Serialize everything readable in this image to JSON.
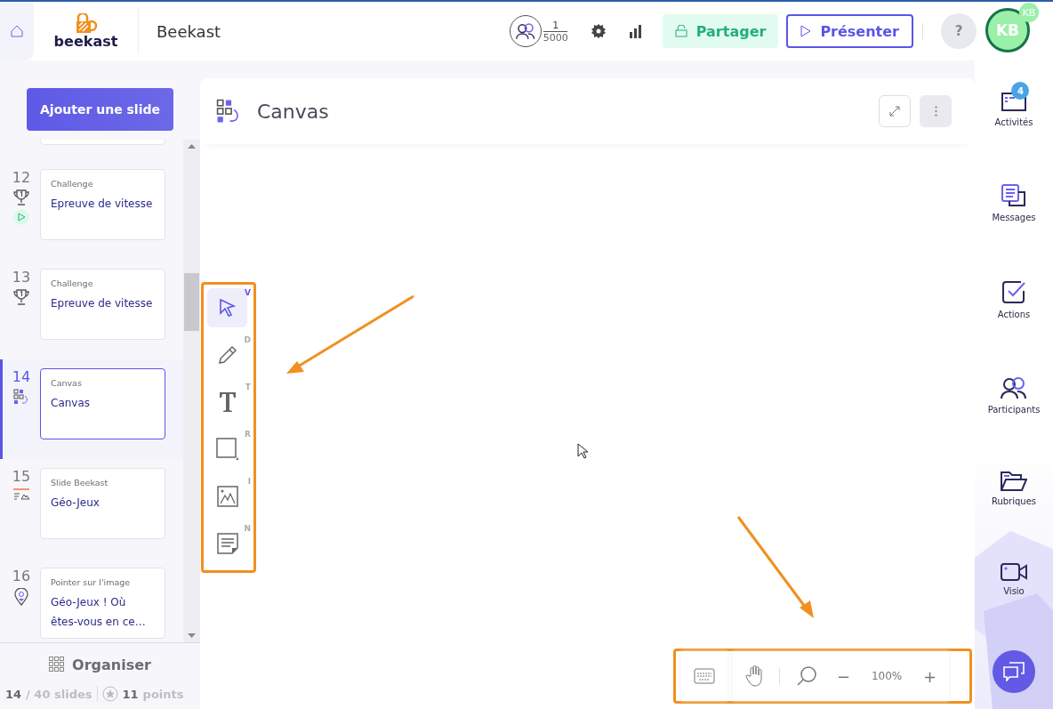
{
  "header": {
    "logo_text": "beekast",
    "title": "Beekast",
    "participants": {
      "count": "1",
      "max": "5000"
    },
    "share_button": "Partager",
    "present_button": "Présenter",
    "help_button": "?",
    "avatar": {
      "initials": "KB",
      "badge": "KB"
    }
  },
  "sidebar": {
    "add_button": "Ajouter une slide",
    "slides": [
      {
        "number": "12",
        "type": "Challenge",
        "title": "Epreuve de vitesse",
        "kind": "trophy",
        "playing": true,
        "selected": false
      },
      {
        "number": "13",
        "type": "Challenge",
        "title": "Epreuve de vitesse",
        "kind": "trophy",
        "playing": false,
        "selected": false
      },
      {
        "number": "14",
        "type": "Canvas",
        "title": "Canvas",
        "kind": "canvas",
        "playing": false,
        "selected": true
      },
      {
        "number": "15",
        "type": "Slide Beekast",
        "title": "Géo-Jeux",
        "kind": "beekast",
        "playing": false,
        "selected": false
      },
      {
        "number": "16",
        "type": "Pointer sur l'image",
        "title": "Géo-Jeux ! Où êtes-vous en ce…",
        "kind": "pin",
        "playing": false,
        "selected": false
      }
    ],
    "organise_button": "Organiser",
    "footer": {
      "current": "14",
      "total": "/ 40 slides",
      "points": "11",
      "points_label": "points"
    }
  },
  "main": {
    "title": "Canvas",
    "tools": [
      {
        "kind": "select",
        "shortcut": "V",
        "selected": true
      },
      {
        "kind": "pencil",
        "shortcut": "D",
        "selected": false
      },
      {
        "kind": "text",
        "shortcut": "T",
        "selected": false
      },
      {
        "kind": "rect",
        "shortcut": "R",
        "selected": false
      },
      {
        "kind": "image",
        "shortcut": "I",
        "selected": false
      },
      {
        "kind": "note",
        "shortcut": "N",
        "selected": false
      }
    ],
    "zoom": {
      "minus": "−",
      "value": "100%",
      "plus": "+"
    }
  },
  "rail": [
    {
      "kind": "activities",
      "label": "Activités",
      "badge": "4"
    },
    {
      "kind": "messages",
      "label": "Messages"
    },
    {
      "kind": "actions",
      "label": "Actions"
    },
    {
      "kind": "participants",
      "label": "Participants"
    },
    {
      "kind": "folders",
      "label": "Rubriques"
    },
    {
      "kind": "video",
      "label": "Visio"
    }
  ]
}
